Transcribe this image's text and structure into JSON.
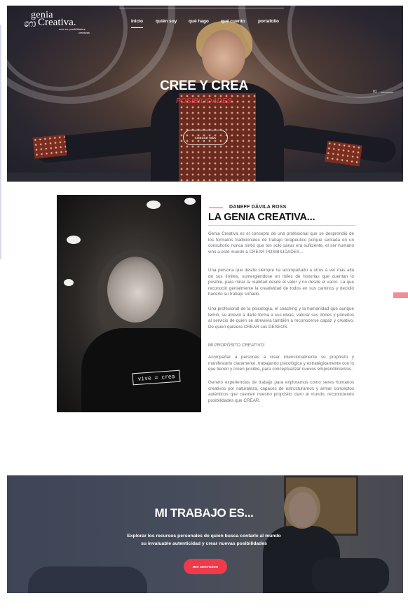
{
  "brand": {
    "logo_line1": "genia",
    "logo_line2": "Creativa.",
    "logo_tag1": "cree en posibilidades",
    "logo_tag2": "creativas"
  },
  "nav": {
    "items": [
      {
        "label": "inicio",
        "active": true
      },
      {
        "label": "quién soy"
      },
      {
        "label": "qué hago"
      },
      {
        "label": "qué cuento"
      },
      {
        "label": "portafolio"
      }
    ]
  },
  "hero": {
    "title": "CREE Y CREA",
    "subtitle": "POSIBILIDADES",
    "button": "CONOCE MÁS",
    "slide_label": "01"
  },
  "about": {
    "author": "DANEFF DÁVILA ROSS",
    "title": "LA GENIA CREATIVA...",
    "shirt_text": "vive = crea",
    "paragraphs": [
      "Genia Creativa es el concepto de una profesional que se desprendió de los formatos tradicionales de trabajo terapéutico porque sentada en un consultorio nunca sintió que ton solo sanar era suficiente, el ser humano vino a este mundo a CREAR POSIBILIDADES...",
      "Una persona que desde siempre ha acompañado a otros a ver más allá de sus límites, sumergiéndose en miles de historias que cuentan lo posible, para mirar la realidad desde el valor y no desde el vacío. La que reconoció genialmente la creatividad de todos en sus caminos y decidió hacerlo su trabajo soñado.",
      "Una profesional de la psicología, el coaching y la humanidad que aunque temió, se atrevió a darle forma a sus ideas, valorar sus dones y ponerlos al servicio de quien se atreviera también a reconocerse capaz y creativo. De quien quisiera CREAR sus DESEOS.",
      "MI PROPÓSITO CREATIVO:",
      "Acompañar a personas a crear intencionalmente su propósito y manifestarlo claramente, trabajando psicológica y estratégicamente con lo que tienen y creen posible, para conceptualizar nuevos emprendimientos.",
      "Genero experiencias de trabajo para exploramos como seres humanos creativos por naturaleza, capaces de estructurarnos y armar conceptos auténticos que cuenten nuestro propósito claro al mundo, reconociendo posibilidades que CREAR."
    ]
  },
  "work": {
    "title": "MI TRABAJO ES...",
    "line1": "Explorar los recursos personales de quien busca contarle al mundo",
    "line2": "su invaluable autenticidad y crear nuevas posibilidades",
    "button": "MIS SERVICIOS"
  },
  "colors": {
    "accent": "#e8424f",
    "button": "#ef3a4b",
    "body_text": "#6d6d72",
    "heading": "#151515"
  }
}
